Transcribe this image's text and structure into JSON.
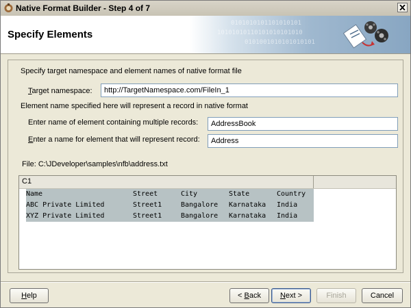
{
  "window": {
    "title": "Native Format Builder - Step 4 of 7"
  },
  "header": {
    "title": "Specify Elements",
    "binary_lines": [
      "0101010101101010101",
      "10101010110101010101010",
      "0101001010101010101"
    ]
  },
  "content": {
    "intro": "Specify target namespace and element names of native format file",
    "target_namespace": {
      "label_mnemonic": "T",
      "label_rest": "arget namespace:",
      "value": "http://TargetNamespace.com/FileIn_1"
    },
    "record_note": "Element name specified here will represent a record in native format",
    "multi_records": {
      "label": "Enter name of element containing multiple records:",
      "value": "AddressBook"
    },
    "record_element": {
      "label_mnemonic": "E",
      "label_rest": "nter a name for element that will represent record:",
      "value": "Address"
    },
    "file_path": "File: C:\\JDeveloper\\samples\\nfb\\address.txt"
  },
  "table": {
    "column_header": "C1",
    "rows": [
      [
        "Name",
        "Street",
        "City",
        "State",
        "Country"
      ],
      [
        "ABC Private Limited",
        "Street1",
        "Bangalore",
        "Karnataka",
        "India"
      ],
      [
        "XYZ Private Limited",
        "Street1",
        "Bangalore",
        "Karnataka",
        "India"
      ]
    ]
  },
  "buttons": {
    "help": {
      "mnemonic": "H",
      "rest": "elp"
    },
    "back": {
      "prefix": "< ",
      "mnemonic": "B",
      "rest": "ack"
    },
    "next": {
      "mnemonic": "N",
      "rest": "ext >"
    },
    "finish": {
      "label": "Finish"
    },
    "cancel": {
      "label": "Cancel"
    }
  },
  "icons": {
    "title": "app-icon",
    "close": "close-icon",
    "header": "file-conversion-icon"
  },
  "colors": {
    "header_gradient": "#88a6c2",
    "grid_selection": "#b7c2c4",
    "field_border": "#7f9db9"
  }
}
